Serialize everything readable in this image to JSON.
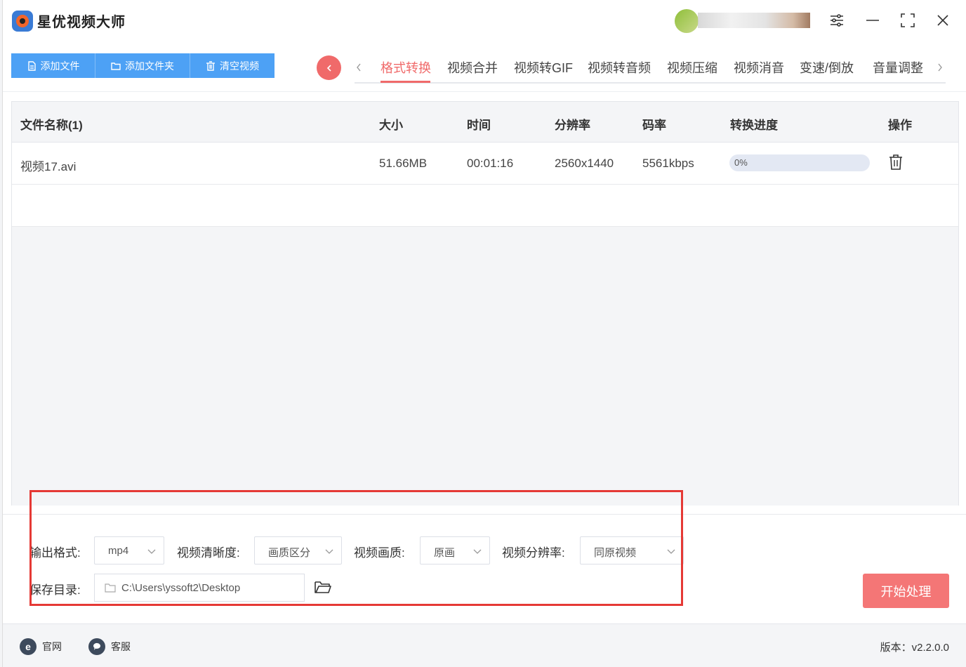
{
  "app": {
    "title": "星优视频大师"
  },
  "toolbar": {
    "add_file": "添加文件",
    "add_folder": "添加文件夹",
    "clear_videos": "清空视频"
  },
  "tabs": [
    {
      "label": "格式转换",
      "active": true
    },
    {
      "label": "视频合并"
    },
    {
      "label": "视频转GIF"
    },
    {
      "label": "视频转音频"
    },
    {
      "label": "视频压缩"
    },
    {
      "label": "视频消音"
    },
    {
      "label": "变速/倒放"
    },
    {
      "label": "音量调整"
    }
  ],
  "table": {
    "headers": {
      "name": "文件名称(1)",
      "size": "大小",
      "duration": "时间",
      "resolution": "分辨率",
      "bitrate": "码率",
      "progress": "转换进度",
      "action": "操作"
    },
    "rows": [
      {
        "name": "视频17.avi",
        "size": "51.66MB",
        "duration": "00:01:16",
        "resolution": "2560x1440",
        "bitrate": "5561kbps",
        "progress_text": "0%",
        "progress": 0
      }
    ]
  },
  "settings": {
    "output_format_label": "输出格式:",
    "output_format_value": "mp4",
    "clarity_label": "视频清晰度:",
    "clarity_value": "画质区分",
    "quality_label": "视频画质:",
    "quality_value": "原画",
    "resolution_label": "视频分辨率:",
    "resolution_value": "同原视频",
    "save_dir_label": "保存目录:",
    "save_dir_value": "C:\\Users\\yssoft2\\Desktop",
    "start_button": "开始处理"
  },
  "footer": {
    "website": "官网",
    "support": "客服",
    "version": "版本：v2.2.0.0"
  },
  "colors": {
    "primary": "#4da1f5",
    "accent": "#f06a6a",
    "start_button": "#f47676",
    "highlight_box": "#e53935"
  },
  "icons": [
    "app-logo-icon",
    "settings-sliders-icon",
    "minimize-icon",
    "maximize-icon",
    "close-icon",
    "document-icon",
    "folder-icon",
    "trash-icon",
    "chevron-left-icon",
    "chevron-right-icon",
    "chevron-down-icon",
    "folder-open-icon",
    "browser-icon",
    "chat-icon"
  ]
}
